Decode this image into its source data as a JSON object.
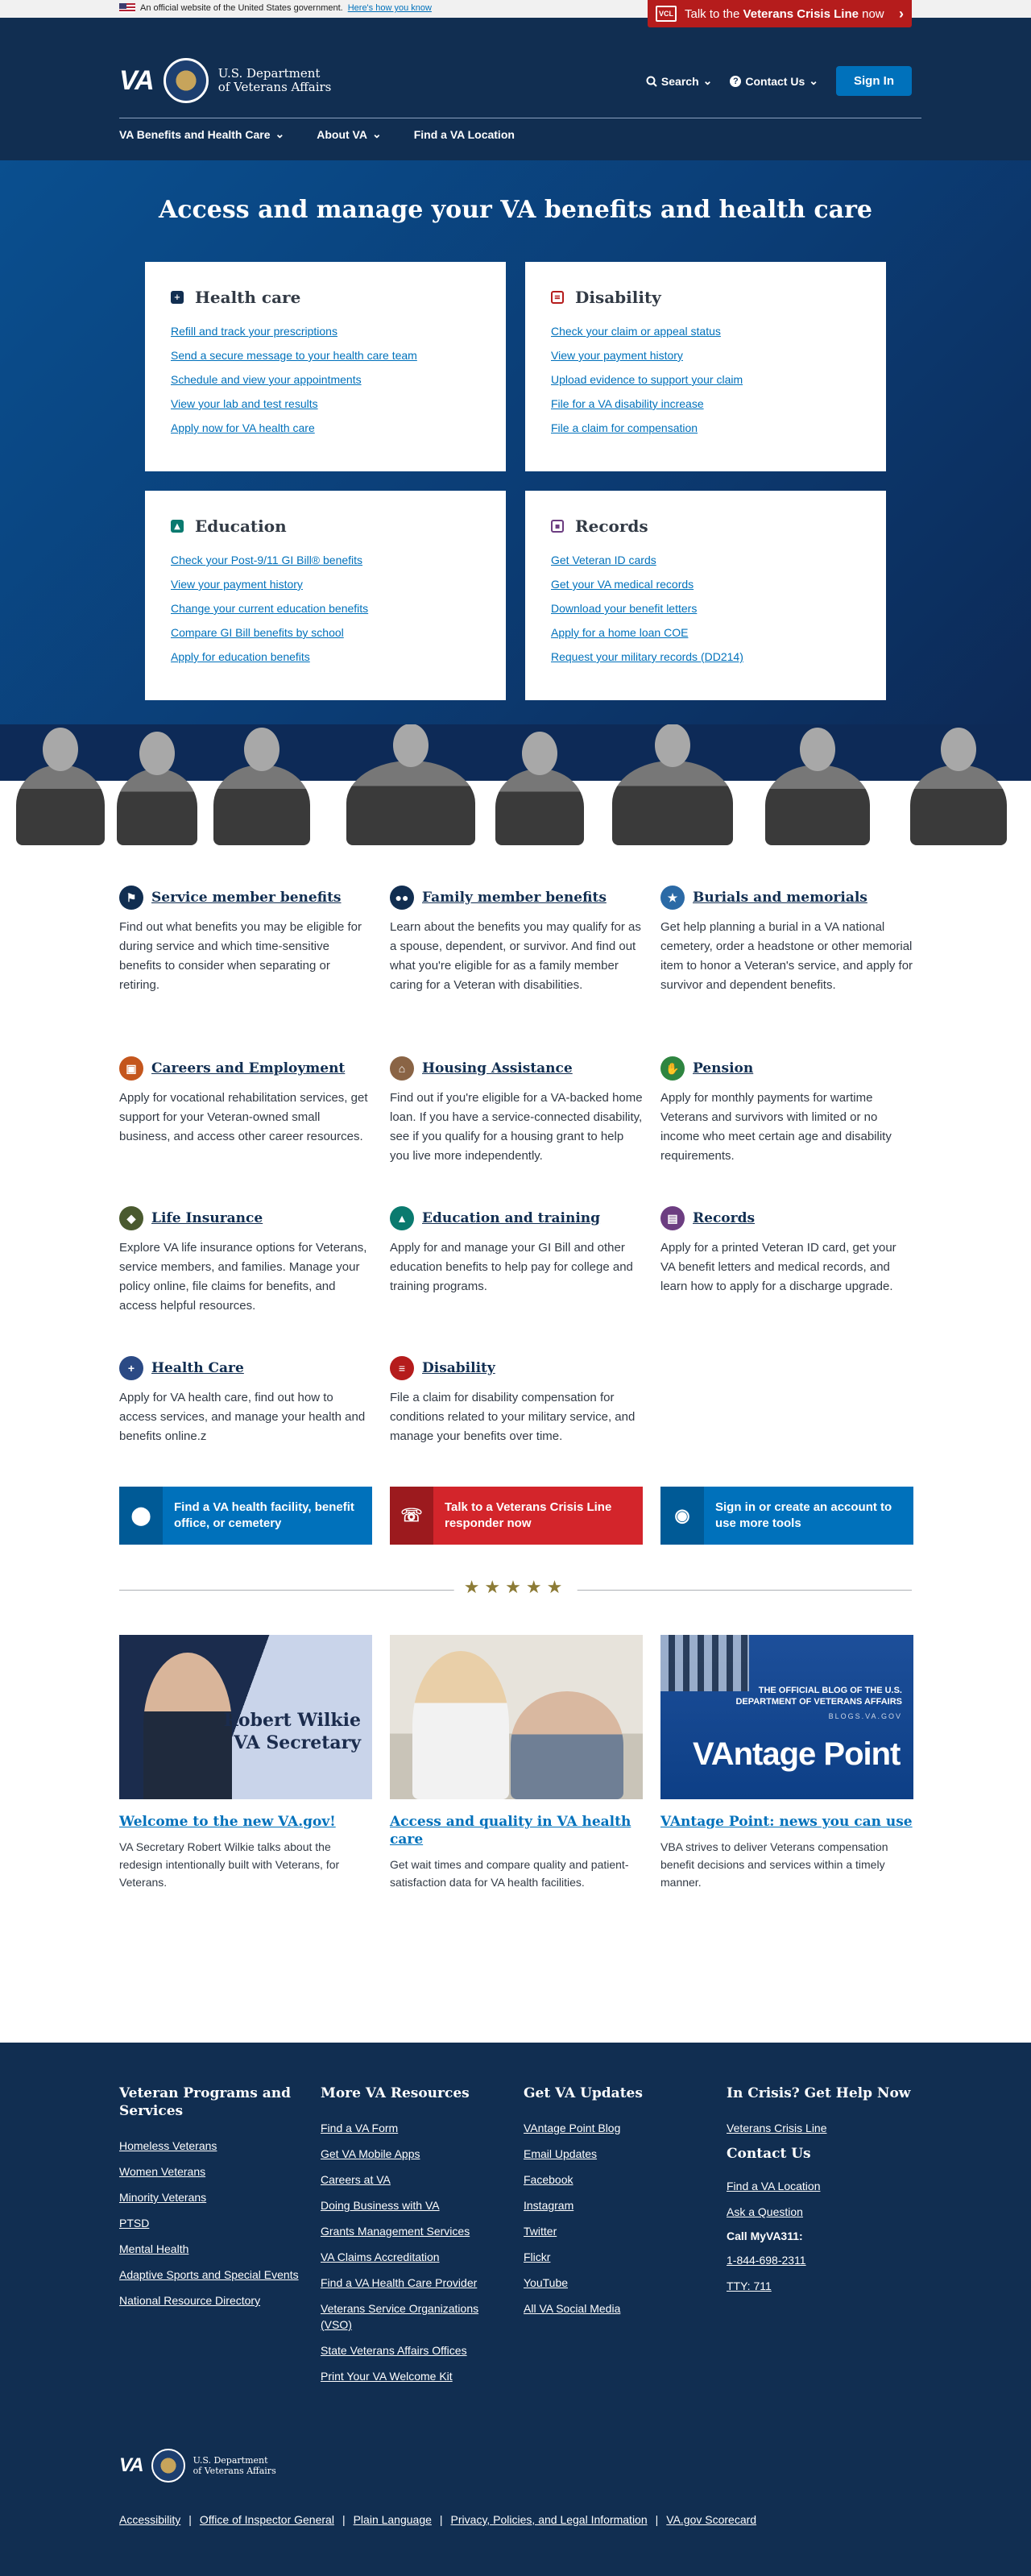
{
  "gov_banner": {
    "text": "An official website of the United States government.",
    "link": "Here's how you know"
  },
  "crisis_line": {
    "prefix": "Talk to the ",
    "bold": "Veterans Crisis Line",
    "suffix": " now",
    "logo_text": "VCL"
  },
  "header": {
    "va_mark": "VA",
    "dept_line1": "U.S. Department",
    "dept_line2": "of Veterans Affairs",
    "search": "Search",
    "contact": "Contact Us",
    "sign_in": "Sign In"
  },
  "nav": [
    {
      "label": "VA Benefits and Health Care",
      "dropdown": true
    },
    {
      "label": "About VA",
      "dropdown": true
    },
    {
      "label": "Find a VA Location",
      "dropdown": false
    }
  ],
  "hero": {
    "title": "Access and manage your VA benefits and health care",
    "hubs": [
      {
        "title": "Health care",
        "icon": "medical-bag-icon",
        "color": "#112e51",
        "links": [
          "Refill and track your prescriptions",
          "Send a secure message to your health care team",
          "Schedule and view your appointments",
          "View your lab and test results",
          "Apply now for VA health care"
        ]
      },
      {
        "title": "Disability",
        "icon": "document-icon",
        "color": "#b51c1c",
        "links": [
          "Check your claim or appeal status",
          "View your payment history",
          "Upload evidence to support your claim",
          "File for a VA disability increase",
          "File a claim for compensation"
        ]
      },
      {
        "title": "Education",
        "icon": "graduation-cap-icon",
        "color": "#0a7a6f",
        "links": [
          "Check your Post-9/11 GI Bill® benefits",
          "View your payment history",
          "Change your current education benefits",
          "Compare GI Bill benefits by school",
          "Apply for education benefits"
        ]
      },
      {
        "title": "Records",
        "icon": "id-card-icon",
        "color": "#6c3d81",
        "links": [
          "Get Veteran ID cards",
          "Get your VA medical records",
          "Download your benefit letters",
          "Apply for a home loan COE",
          "Request your military records (DD214)"
        ]
      }
    ]
  },
  "benefits": [
    {
      "title": "Service member benefits",
      "icon": "flag-icon",
      "color": "#112e51",
      "desc": "Find out what benefits you may be eligible for during service and which time-sensitive benefits to consider when separating or retiring."
    },
    {
      "title": "Family member benefits",
      "icon": "family-icon",
      "color": "#112e51",
      "desc": "Learn about the benefits you may qualify for as a spouse, dependent, or survivor. And find out what you're eligible for as a family member caring for a Veteran with disabilities."
    },
    {
      "title": "Burials and memorials",
      "icon": "star-icon",
      "color": "#2b6aa6",
      "desc": "Get help planning a burial in a VA national cemetery, order a headstone or other memorial item to honor a Veteran's service, and apply for survivor and dependent benefits."
    },
    {
      "title": "Careers and Employment",
      "icon": "briefcase-icon",
      "color": "#c4561d",
      "desc": "Apply for vocational rehabilitation services, get support for your Veteran-owned small business, and access other career resources."
    },
    {
      "title": "Housing Assistance",
      "icon": "home-icon",
      "color": "#8a6445",
      "desc": "Find out if you're eligible for a VA-backed home loan. If you have a service-connected disability, see if you qualify for a housing grant to help you live more independently."
    },
    {
      "title": "Pension",
      "icon": "handshake-icon",
      "color": "#2e8540",
      "desc": "Apply for monthly payments for wartime Veterans and survivors with limited or no income who meet certain age and disability requirements."
    },
    {
      "title": "Life Insurance",
      "icon": "shield-icon",
      "color": "#4a5a2f",
      "desc": "Explore VA life insurance options for Veterans, service members, and families. Manage your policy online, file claims for benefits, and access helpful resources."
    },
    {
      "title": "Education and training",
      "icon": "graduation-cap-icon",
      "color": "#0a7a6f",
      "desc": "Apply for and manage your GI Bill and other education benefits to help pay for college and training programs."
    },
    {
      "title": "Records",
      "icon": "id-card-icon",
      "color": "#6c3d81",
      "desc": "Apply for a printed Veteran ID card, get your VA benefit letters and medical records, and learn how to apply for a discharge upgrade."
    },
    {
      "title": "Health Care",
      "icon": "medical-bag-icon",
      "color": "#2b4a85",
      "desc": "Apply for VA health care, find out how to access services, and manage your health and benefits online.z"
    },
    {
      "title": "Disability",
      "icon": "document-icon",
      "color": "#b51c1c",
      "desc": "File a claim for disability compensation for conditions related to your military service, and manage your benefits over time."
    }
  ],
  "cta": [
    {
      "label": "Find a VA health facility, benefit office, or cemetery",
      "icon": "map-pin-icon",
      "color": "#0071bb"
    },
    {
      "label": "Talk to a Veterans Crisis Line responder now",
      "icon": "crisis-line-icon",
      "color": "#d3252b"
    },
    {
      "label": "Sign in or create an account to use more tools",
      "icon": "user-icon",
      "color": "#0071bb"
    }
  ],
  "news": [
    {
      "title": "Welcome to the new VA.gov!",
      "desc": "VA Secretary Robert Wilkie talks about the redesign intentionally built with Veterans, for Veterans.",
      "img_text_1": "Robert Wilkie",
      "img_text_2": "VA Secretary"
    },
    {
      "title": "Access and quality in VA health care",
      "desc": "Get wait times and compare quality and patient-satisfaction data for VA health facilities."
    },
    {
      "title": "VAntage Point: news you can use",
      "desc": "VBA strives to deliver Veterans compensation benefit decisions and services within a timely manner.",
      "img_text_1": "THE OFFICIAL BLOG OF THE U.S. DEPARTMENT OF VETERANS AFFAIRS",
      "img_text_2": "BLOGS.VA.GOV",
      "img_text_3": "VAntage Point"
    }
  ],
  "footer": {
    "col1": {
      "title": "Veteran Programs and Services",
      "links": [
        "Homeless Veterans",
        "Women Veterans",
        "Minority Veterans",
        "PTSD",
        "Mental Health",
        "Adaptive Sports and Special Events",
        "National Resource Directory"
      ]
    },
    "col2": {
      "title": "More VA Resources",
      "links": [
        "Find a VA Form",
        "Get VA Mobile Apps",
        "Careers at VA",
        "Doing Business with VA",
        "Grants Management Services",
        "VA Claims Accreditation",
        "Find a VA Health Care Provider",
        "Veterans Service Organizations (VSO)",
        "State Veterans Affairs Offices",
        "Print Your VA Welcome Kit"
      ]
    },
    "col3": {
      "title": "Get VA Updates",
      "links": [
        "VAntage Point Blog",
        "Email Updates",
        "Facebook",
        "Instagram",
        "Twitter",
        "Flickr",
        "YouTube",
        "All VA Social Media"
      ]
    },
    "col4": {
      "title": "In Crisis? Get Help Now",
      "crisis_link": "Veterans Crisis Line",
      "contact_title": "Contact Us",
      "contact_links": [
        "Find a VA Location",
        "Ask a Question"
      ],
      "call_label": "Call MyVA311:",
      "phone": "1-844-698-2311",
      "tty": "TTY: 711"
    },
    "bottom_links": [
      "Accessibility",
      "Office of Inspector General",
      "Plain Language",
      "Privacy, Policies, and Legal Information",
      "VA.gov Scorecard"
    ]
  }
}
